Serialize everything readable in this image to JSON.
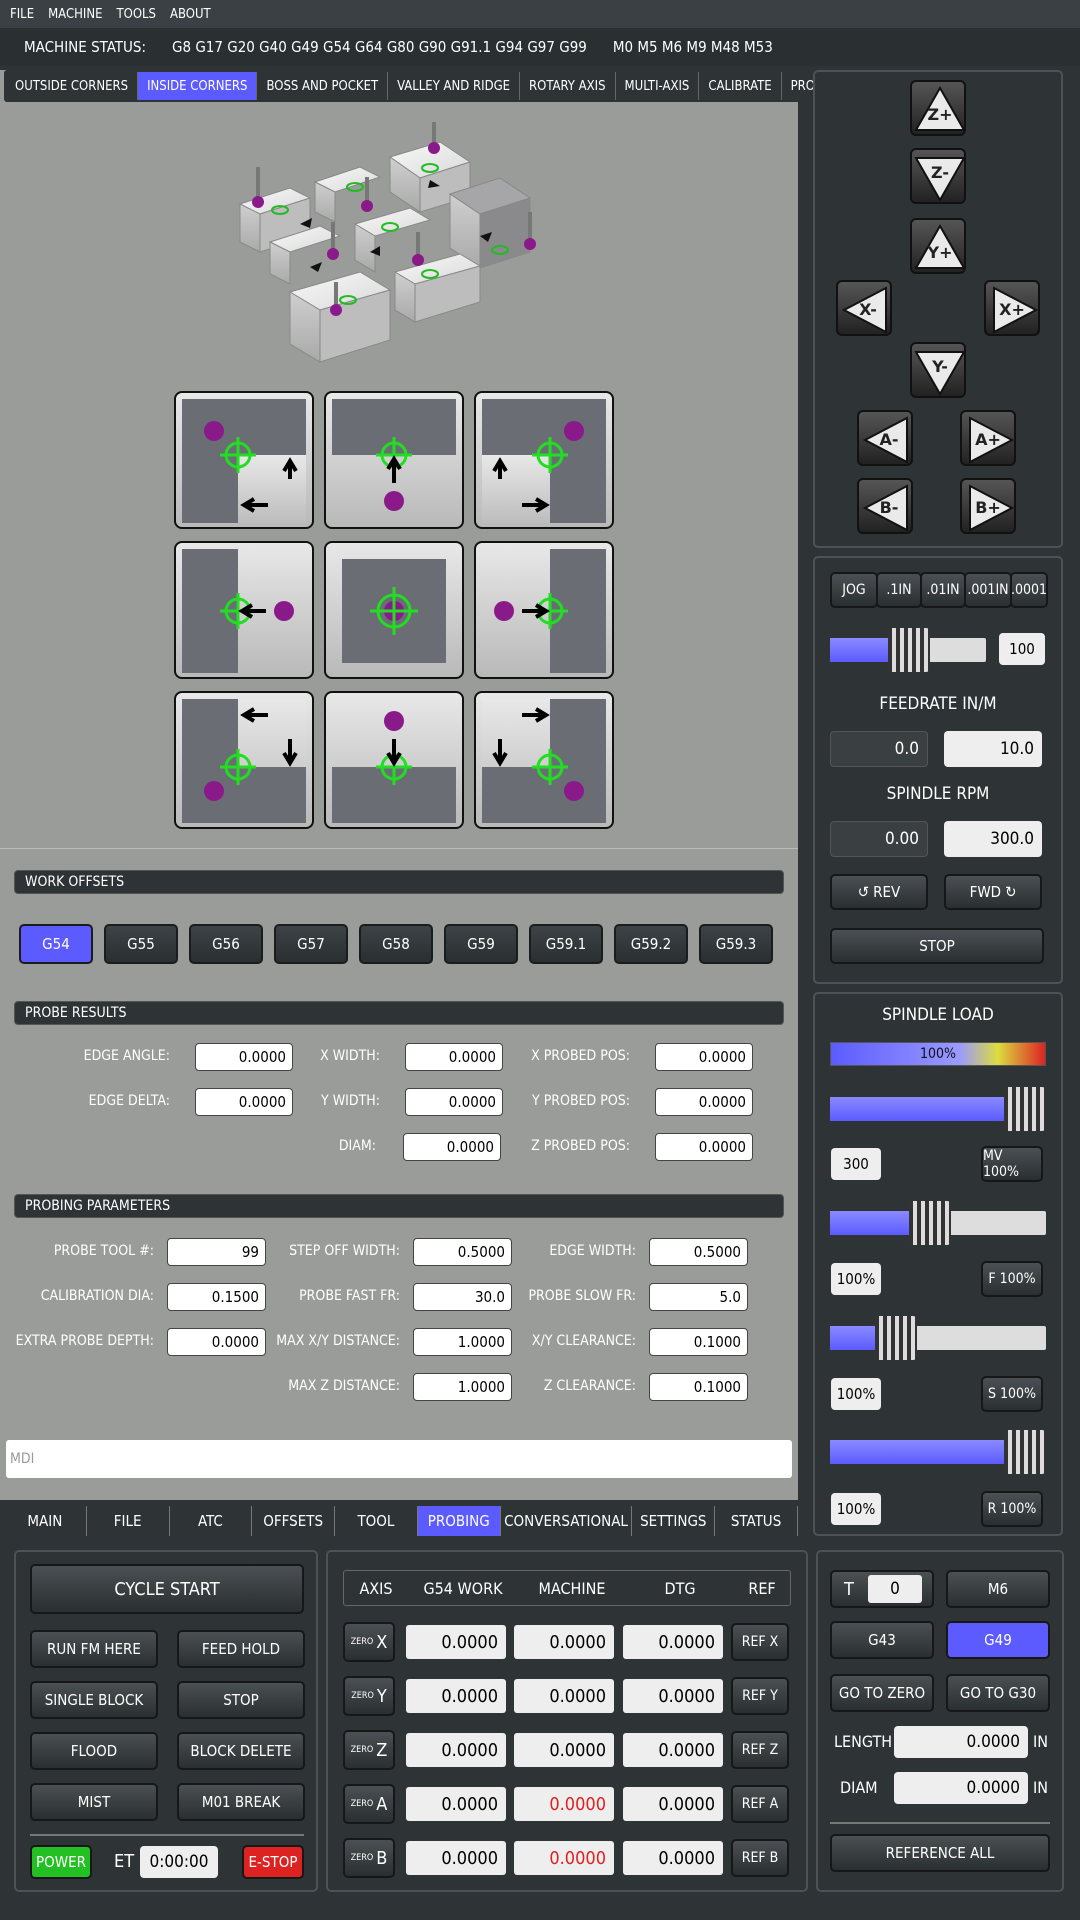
{
  "menu": [
    "FILE",
    "MACHINE",
    "TOOLS",
    "ABOUT"
  ],
  "status": {
    "label": "MACHINE STATUS:",
    "gcodes": "G8 G17 G20 G40 G49 G54 G64 G80 G90 G91.1 G94 G97 G99",
    "mcodes": "M0 M5 M6 M9 M48 M53"
  },
  "probe_tabs": [
    "OUTSIDE CORNERS",
    "INSIDE CORNERS",
    "BOSS AND POCKET",
    "VALLEY AND RIDGE",
    "ROTARY AXIS",
    "MULTI-AXIS",
    "CALIBRATE",
    "PROBE HELP"
  ],
  "work_offsets": {
    "title": "WORK OFFSETS",
    "buttons": [
      "G54",
      "G55",
      "G56",
      "G57",
      "G58",
      "G59",
      "G59.1",
      "G59.2",
      "G59.3"
    ]
  },
  "probe_results": {
    "title": "PROBE RESULTS",
    "edge_angle": {
      "label": "EDGE ANGLE:",
      "value": "0.0000"
    },
    "edge_delta": {
      "label": "EDGE DELTA:",
      "value": "0.0000"
    },
    "x_width": {
      "label": "X WIDTH:",
      "value": "0.0000"
    },
    "y_width": {
      "label": "Y WIDTH:",
      "value": "0.0000"
    },
    "diam": {
      "label": "DIAM:",
      "value": "0.0000"
    },
    "x_probed": {
      "label": "X PROBED POS:",
      "value": "0.0000"
    },
    "y_probed": {
      "label": "Y PROBED POS:",
      "value": "0.0000"
    },
    "z_probed": {
      "label": "Z PROBED POS:",
      "value": "0.0000"
    }
  },
  "probing_params": {
    "title": "PROBING PARAMETERS",
    "probe_tool": {
      "label": "PROBE TOOL #:",
      "value": "99"
    },
    "cal_dia": {
      "label": "CALIBRATION DIA:",
      "value": "0.1500"
    },
    "extra_depth": {
      "label": "EXTRA PROBE DEPTH:",
      "value": "0.0000"
    },
    "step_off": {
      "label": "STEP OFF WIDTH:",
      "value": "0.5000"
    },
    "fast_fr": {
      "label": "PROBE FAST FR:",
      "value": "30.0"
    },
    "max_xy": {
      "label": "MAX X/Y DISTANCE:",
      "value": "1.0000"
    },
    "max_z": {
      "label": "MAX Z DISTANCE:",
      "value": "1.0000"
    },
    "edge_width": {
      "label": "EDGE WIDTH:",
      "value": "0.5000"
    },
    "slow_fr": {
      "label": "PROBE SLOW FR:",
      "value": "5.0"
    },
    "xy_clear": {
      "label": "X/Y CLEARANCE:",
      "value": "0.1000"
    },
    "z_clear": {
      "label": "Z CLEARANCE:",
      "value": "0.1000"
    }
  },
  "mdi": {
    "placeholder": "MDI"
  },
  "nav_tabs": [
    "MAIN",
    "FILE",
    "ATC",
    "OFFSETS",
    "TOOL",
    "PROBING",
    "CONVERSATIONAL",
    "SETTINGS",
    "STATUS"
  ],
  "jog": {
    "zp": "Z+",
    "zm": "Z-",
    "yp": "Y+",
    "ym": "Y-",
    "xm": "X-",
    "xp": "X+",
    "am": "A-",
    "ap": "A+",
    "bm": "B-",
    "bp": "B+"
  },
  "increments": [
    "JOG",
    ".1IN",
    ".01IN",
    ".001IN",
    ".0001"
  ],
  "jog_rate": {
    "value": "100",
    "level": 0.5
  },
  "feedrate": {
    "title": "FEEDRATE IN/M",
    "actual": "0.0",
    "set": "10.0"
  },
  "spindle": {
    "title": "SPINDLE RPM",
    "actual": "0.00",
    "set": "300.0",
    "rev": "REV",
    "fwd": "FWD",
    "stop": "STOP"
  },
  "spindle_load": {
    "title": "SPINDLE LOAD",
    "load": "100%",
    "level": 1.0
  },
  "overrides": [
    {
      "value": "300",
      "button": "MV 100%",
      "level": 0.92
    },
    {
      "value": "100%",
      "button": "F 100%",
      "level": 0.46
    },
    {
      "value": "100%",
      "button": "S 100%",
      "level": 0.3
    },
    {
      "value": "100%",
      "button": "R 100%",
      "level": 0.92
    }
  ],
  "controls": {
    "cycle_start": "CYCLE START",
    "run_from_here": "RUN FM HERE",
    "feed_hold": "FEED HOLD",
    "single_block": "SINGLE BLOCK",
    "stop": "STOP",
    "flood": "FLOOD",
    "block_delete": "BLOCK DELETE",
    "mist": "MIST",
    "m01": "M01 BREAK",
    "power": "POWER",
    "et_label": "ET",
    "et_value": "0:00:00",
    "estop": "E-STOP"
  },
  "dro": {
    "headers": [
      "AXIS",
      "G54 WORK",
      "MACHINE",
      "DTG",
      "REF"
    ],
    "zero_label": "ZERO",
    "rows": [
      {
        "axis": "X",
        "work": "0.0000",
        "machine": "0.0000",
        "dtg": "0.0000",
        "ref": "REF X"
      },
      {
        "axis": "Y",
        "work": "0.0000",
        "machine": "0.0000",
        "dtg": "0.0000",
        "ref": "REF Y"
      },
      {
        "axis": "Z",
        "work": "0.0000",
        "machine": "0.0000",
        "dtg": "0.0000",
        "ref": "REF Z"
      },
      {
        "axis": "A",
        "work": "0.0000",
        "machine": "0.0000",
        "dtg": "0.0000",
        "ref": "REF A"
      },
      {
        "axis": "B",
        "work": "0.0000",
        "machine": "0.0000",
        "dtg": "0.0000",
        "ref": "REF B"
      }
    ]
  },
  "tool": {
    "t_label": "T",
    "t_value": "0",
    "m6": "M6",
    "g43": "G43",
    "g49": "G49",
    "go_zero": "GO TO ZERO",
    "go_g30": "GO TO G30",
    "length_label": "LENGTH",
    "length_value": "0.0000",
    "diam_label": "DIAM",
    "diam_value": "0.0000",
    "unit": "IN",
    "ref_all": "REFERENCE ALL"
  },
  "colors": {
    "accent": "#5b5bff",
    "power": "#22c022",
    "estop": "#dd2222",
    "probe_ring": "#22dd22",
    "ball": "#8a1a8a"
  }
}
